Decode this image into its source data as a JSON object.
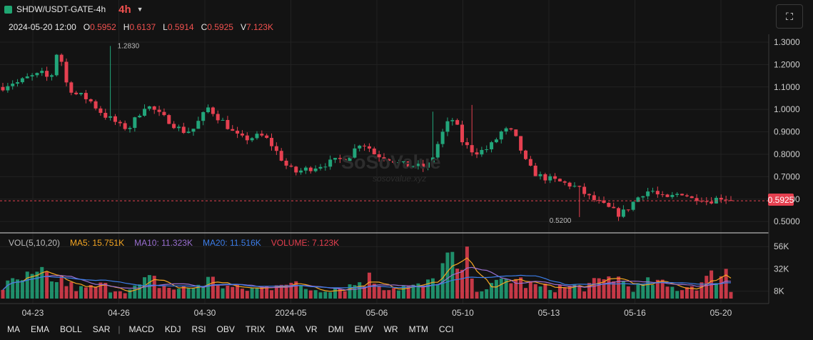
{
  "header": {
    "symbol": "SHDW/USDT-GATE-4h",
    "timeframe": "4h"
  },
  "ohlc": {
    "date": "2024-05-20 12:00",
    "o_label": "O",
    "o": "0.5952",
    "h_label": "H",
    "h": "0.6137",
    "l_label": "L",
    "l": "0.5914",
    "c_label": "C",
    "c": "0.5925",
    "v_label": "V",
    "v": "7.123K"
  },
  "volume_legend": {
    "name": "VOL(5,10,20)",
    "ma5": "MA5: 15.751K",
    "ma10": "MA10: 11.323K",
    "ma20": "MA20: 11.516K",
    "volume": "VOLUME: 7.123K"
  },
  "colors": {
    "up": "#22a57a",
    "down": "#e54050",
    "ma5": "#f5a623",
    "ma10": "#9a6fd0",
    "ma20": "#3c7de8",
    "grid": "#222222"
  },
  "indicators": [
    "MA",
    "EMA",
    "BOLL",
    "SAR",
    "MACD",
    "KDJ",
    "RSI",
    "OBV",
    "TRIX",
    "DMA",
    "VR",
    "DMI",
    "EMV",
    "WR",
    "MTM",
    "CCI"
  ],
  "watermark": "sosovalue.xyz",
  "chart_data": {
    "type": "candlestick",
    "price_axis": {
      "ticks": [
        "1.3000",
        "1.2000",
        "1.1000",
        "1.0000",
        "0.9000",
        "0.8000",
        "0.7000",
        "0.6000",
        "0.5000"
      ],
      "range": [
        0.475,
        1.335
      ]
    },
    "volume_axis": {
      "ticks": [
        "56K",
        "32K",
        "8K"
      ],
      "range": [
        0,
        60000
      ]
    },
    "x_ticks": [
      "04-23",
      "04-26",
      "04-30",
      "2024-05",
      "05-06",
      "05-10",
      "05-13",
      "05-16",
      "05-20"
    ],
    "last_price": "0.5925",
    "annotations": {
      "high": "1.2830",
      "low": "0.5200"
    },
    "price_path": [
      1.1,
      1.12,
      1.12,
      1.14,
      1.15,
      1.16,
      1.13,
      1.28,
      1.12,
      1.07,
      1.06,
      1.04,
      1.0,
      0.97,
      0.95,
      0.92,
      0.92,
      0.97,
      1.02,
      1.0,
      0.97,
      0.95,
      0.92,
      0.9,
      0.91,
      0.96,
      1.01,
      0.97,
      0.94,
      0.9,
      0.87,
      0.87,
      0.88,
      0.88,
      0.84,
      0.79,
      0.74,
      0.72,
      0.73,
      0.74,
      0.75,
      0.76,
      0.77,
      0.78,
      0.8,
      0.85,
      0.84,
      0.8,
      0.79,
      0.78,
      0.76,
      0.75,
      0.75,
      0.74,
      0.76,
      0.85,
      0.93,
      0.96,
      0.86,
      0.82,
      0.81,
      0.82,
      0.85,
      0.9,
      0.91,
      0.86,
      0.77,
      0.72,
      0.7,
      0.69,
      0.68,
      0.67,
      0.66,
      0.64,
      0.61,
      0.59,
      0.57,
      0.55,
      0.53,
      0.56,
      0.6,
      0.63,
      0.64,
      0.61,
      0.6,
      0.62,
      0.63,
      0.6,
      0.61,
      0.59,
      0.6,
      0.61,
      0.59
    ],
    "volume_path": [
      12,
      16,
      18,
      22,
      20,
      28,
      14,
      24,
      16,
      12,
      10,
      11,
      14,
      13,
      10,
      11,
      9,
      12,
      18,
      20,
      14,
      12,
      10,
      11,
      12,
      16,
      20,
      18,
      13,
      12,
      10,
      10,
      11,
      12,
      13,
      24,
      16,
      14,
      12,
      10,
      10,
      11,
      12,
      12,
      14,
      18,
      22,
      20,
      14,
      12,
      12,
      13,
      12,
      14,
      16,
      24,
      42,
      36,
      22,
      16,
      12,
      12,
      13,
      18,
      22,
      20,
      16,
      14,
      12,
      11,
      12,
      12,
      13,
      12,
      14,
      16,
      18,
      26,
      20,
      14,
      12,
      14,
      18,
      16,
      12,
      11,
      12,
      14,
      15,
      20,
      26,
      30,
      7
    ]
  }
}
